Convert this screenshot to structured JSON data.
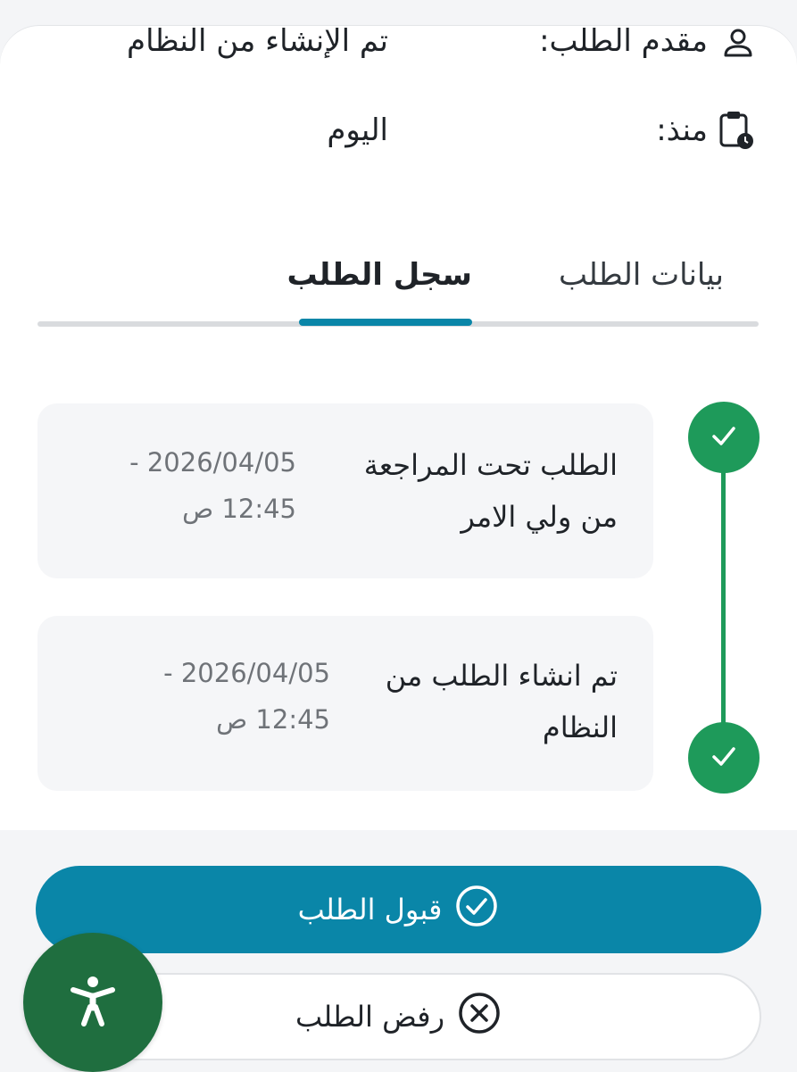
{
  "request_info": {
    "applicant_label": "مقدم الطلب:",
    "applicant_value": "تم الإنشاء من النظام",
    "since_label": "منذ:",
    "since_value": "اليوم"
  },
  "tabs": [
    {
      "label": "بيانات الطلب",
      "active": false
    },
    {
      "label": "سجل الطلب",
      "active": true
    }
  ],
  "timeline": [
    {
      "title": "الطلب تحت المراجعة من ولي الامر",
      "date": "2026/04/05 - 12:45 ص",
      "status": "completed"
    },
    {
      "title": "تم انشاء الطلب من النظام",
      "date": "2026/04/05 - 12:45 ص",
      "status": "completed"
    }
  ],
  "actions": {
    "accept_label": "قبول الطلب",
    "reject_label": "رفض الطلب"
  },
  "icons": {
    "applicant": "person-icon",
    "since": "clipboard-clock-icon",
    "accept": "check-circle-icon",
    "reject": "x-circle-icon",
    "timeline": "check-icon",
    "fab": "accessibility-icon"
  },
  "colors": {
    "accent": "#0a86a8",
    "success": "#1e9a5a",
    "fab": "#1f6e3f"
  }
}
